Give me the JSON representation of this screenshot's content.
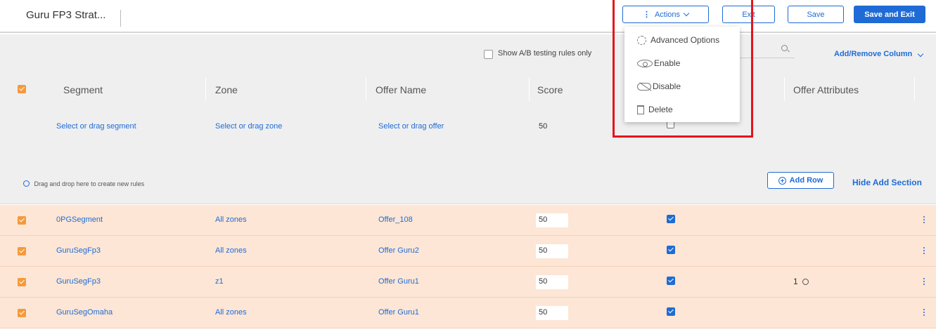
{
  "header": {
    "title": "Guru FP3 Strat...",
    "actions_label": "Actions",
    "exit_label": "Exit",
    "save_label": "Save",
    "save_exit_label": "Save and Exit"
  },
  "toolbar": {
    "ab_label": "Show A/B testing rules only",
    "add_remove_column": "Add/Remove Column"
  },
  "columns": [
    "Segment",
    "Zone",
    "Offer Name",
    "Score",
    "Offer Attributes"
  ],
  "add_row": {
    "segment_placeholder": "Select or drag segment",
    "zone_placeholder": "Select or drag zone",
    "offer_placeholder": "Select or drag offer",
    "score": "50"
  },
  "add_section": {
    "hint": "Drag and drop here to create new rules",
    "add_row_label": "Add Row",
    "hide_label": "Hide Add Section"
  },
  "rows": [
    {
      "segment": "0PGSegment",
      "zone": "All zones",
      "offer": "Offer_108",
      "score": "50",
      "attributes": ""
    },
    {
      "segment": "GuruSegFp3",
      "zone": "All zones",
      "offer": "Offer Guru2",
      "score": "50",
      "attributes": ""
    },
    {
      "segment": "GuruSegFp3",
      "zone": "z1",
      "offer": "Offer Guru1",
      "score": "50",
      "attributes": "1"
    },
    {
      "segment": "GuruSegOmaha",
      "zone": "All zones",
      "offer": "Offer Guru1",
      "score": "50",
      "attributes": ""
    }
  ],
  "actions_menu": {
    "advanced": "Advanced Options",
    "enable": "Enable",
    "disable": "Disable",
    "delete": "Delete"
  },
  "colors": {
    "accent": "#1f6bd6",
    "row_highlight": "#fde6d5",
    "checkbox_orange": "#f59a3b",
    "annotation_red": "#e4141b"
  }
}
